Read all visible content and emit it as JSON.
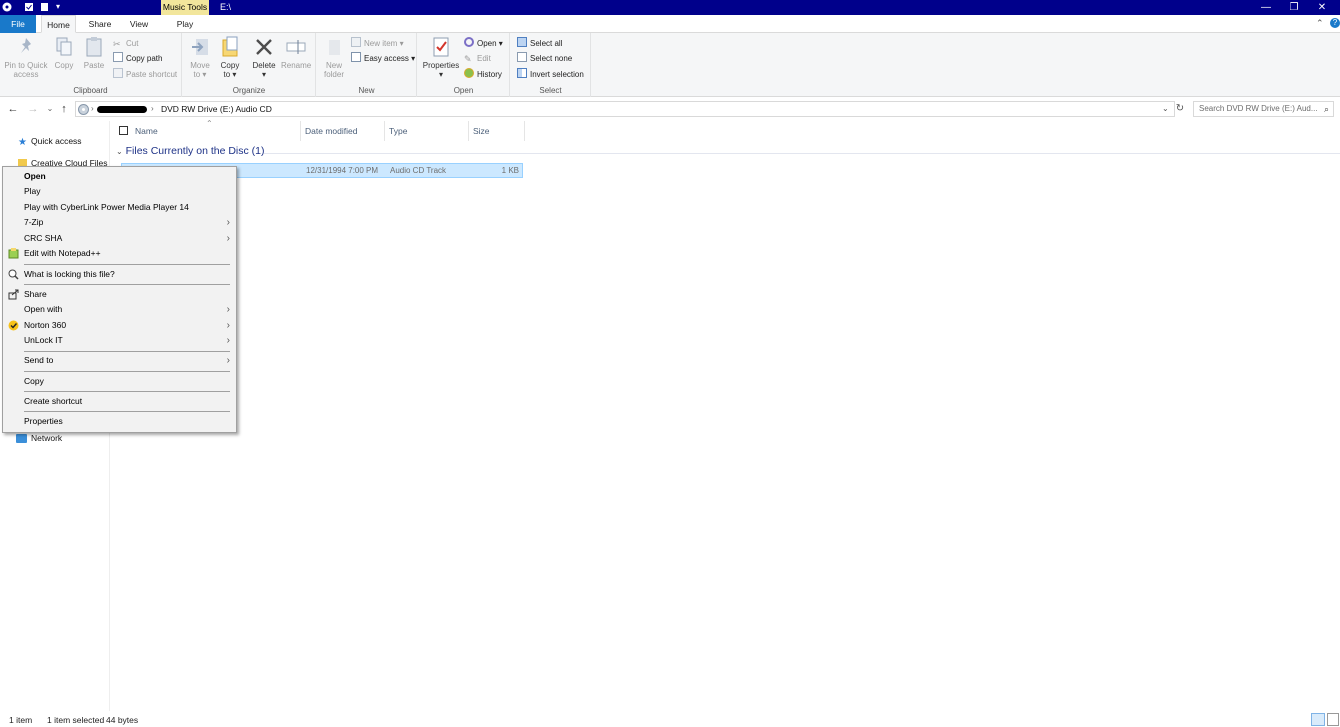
{
  "titlebar": {
    "context_tab": "Music Tools",
    "path": "E:\\",
    "minimize": "—",
    "restore": "❐",
    "close": "✕"
  },
  "tabs": {
    "file": "File",
    "home": "Home",
    "share": "Share",
    "view": "View",
    "play": "Play"
  },
  "ribbon": {
    "clipboard": {
      "label": "Clipboard",
      "pin_line1": "Pin to Quick",
      "pin_line2": "access",
      "copy": "Copy",
      "paste": "Paste",
      "cut": "Cut",
      "copy_path": "Copy path",
      "paste_shortcut": "Paste shortcut"
    },
    "organize": {
      "label": "Organize",
      "move_to_line1": "Move",
      "move_to_line2": "to",
      "copy_to_line1": "Copy",
      "copy_to_line2": "to",
      "delete": "Delete",
      "rename": "Rename"
    },
    "new": {
      "label": "New",
      "new_folder_line1": "New",
      "new_folder_line2": "folder",
      "new_item": "New item",
      "easy_access": "Easy access"
    },
    "open": {
      "label": "Open",
      "properties": "Properties",
      "open": "Open",
      "edit": "Edit",
      "history": "History"
    },
    "select": {
      "label": "Select",
      "select_all": "Select all",
      "select_none": "Select none",
      "invert_selection": "Invert selection"
    }
  },
  "address": {
    "path_current": "DVD RW Drive (E:) Audio CD",
    "search_placeholder": "Search DVD RW Drive (E:) Aud..."
  },
  "navpane": {
    "quick_access": "Quick access",
    "creative_cloud": "Creative Cloud Files",
    "network": "Network"
  },
  "columns": {
    "name": "Name",
    "date_modified": "Date modified",
    "type": "Type",
    "size": "Size"
  },
  "group": {
    "header": "Files Currently on the Disc (1)"
  },
  "file": {
    "date": "12/31/1994 7:00 PM",
    "type": "Audio CD Track",
    "size": "1 KB"
  },
  "context_menu": {
    "open": "Open",
    "play": "Play",
    "play_cyberlink": "Play with CyberLink Power Media Player 14",
    "seven_zip": "7-Zip",
    "crc_sha": "CRC SHA",
    "edit_notepad": "Edit with Notepad++",
    "what_locking": "What is locking this file?",
    "share": "Share",
    "open_with": "Open with",
    "norton": "Norton 360",
    "unlock_it": "UnLock IT",
    "send_to": "Send to",
    "copy": "Copy",
    "create_shortcut": "Create shortcut",
    "properties": "Properties"
  },
  "statusbar": {
    "item_count": "1 item",
    "selected": "1 item selected",
    "size": "44 bytes"
  },
  "colors": {
    "titlebar": "#00008b",
    "file_tab": "#1979ca",
    "music_tools": "#f2e69c",
    "selection": "#cce8ff",
    "group_header": "#1e3287"
  }
}
